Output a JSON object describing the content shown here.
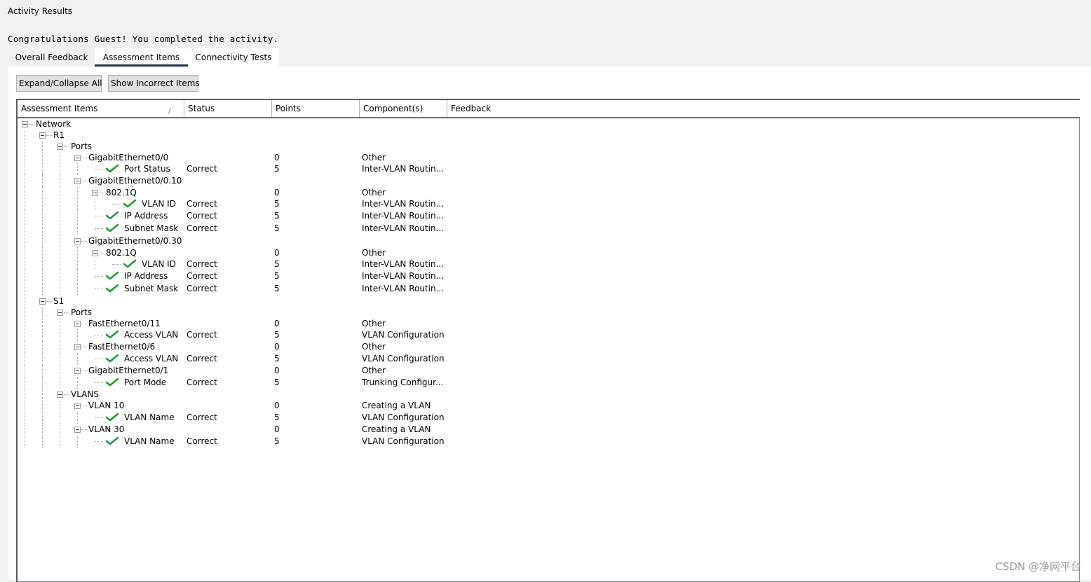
{
  "window": {
    "title": "Activity Results"
  },
  "message": "Congratulations Guest! You completed the activity.",
  "tabs": [
    {
      "label": "Overall Feedback",
      "active": false
    },
    {
      "label": "Assessment Items",
      "active": true
    },
    {
      "label": "Connectivity Tests",
      "active": false
    }
  ],
  "toolbar": {
    "expand_label": "Expand/Collapse All",
    "incorrect_label": "Show Incorrect Items"
  },
  "columns": [
    "Assessment Items",
    "Status",
    "Points",
    "Component(s)",
    "Feedback"
  ],
  "tree": [
    {
      "depth": 0,
      "expandable": true,
      "checked": false,
      "label": "Network",
      "status": "",
      "points": "",
      "component": ""
    },
    {
      "depth": 1,
      "expandable": true,
      "checked": false,
      "label": "R1",
      "status": "",
      "points": "",
      "component": ""
    },
    {
      "depth": 2,
      "expandable": true,
      "checked": false,
      "label": "Ports",
      "status": "",
      "points": "",
      "component": ""
    },
    {
      "depth": 3,
      "expandable": true,
      "checked": false,
      "label": "GigabitEthernet0/0",
      "status": "",
      "points": "0",
      "component": "Other"
    },
    {
      "depth": 4,
      "expandable": false,
      "checked": true,
      "label": "Port Status",
      "status": "Correct",
      "points": "5",
      "component": "Inter-VLAN Routin..."
    },
    {
      "depth": 3,
      "expandable": true,
      "checked": false,
      "label": "GigabitEthernet0/0.10",
      "status": "",
      "points": "",
      "component": ""
    },
    {
      "depth": 4,
      "expandable": true,
      "checked": false,
      "label": "802.1Q",
      "status": "",
      "points": "0",
      "component": "Other"
    },
    {
      "depth": 5,
      "expandable": false,
      "checked": true,
      "label": "VLAN ID",
      "status": "Correct",
      "points": "5",
      "component": "Inter-VLAN Routin..."
    },
    {
      "depth": 4,
      "expandable": false,
      "checked": true,
      "label": "IP Address",
      "status": "Correct",
      "points": "5",
      "component": "Inter-VLAN Routin..."
    },
    {
      "depth": 4,
      "expandable": false,
      "checked": true,
      "label": "Subnet Mask",
      "status": "Correct",
      "points": "5",
      "component": "Inter-VLAN Routin..."
    },
    {
      "depth": 3,
      "expandable": true,
      "checked": false,
      "label": "GigabitEthernet0/0.30",
      "status": "",
      "points": "",
      "component": ""
    },
    {
      "depth": 4,
      "expandable": true,
      "checked": false,
      "label": "802.1Q",
      "status": "",
      "points": "0",
      "component": "Other"
    },
    {
      "depth": 5,
      "expandable": false,
      "checked": true,
      "label": "VLAN ID",
      "status": "Correct",
      "points": "5",
      "component": "Inter-VLAN Routin..."
    },
    {
      "depth": 4,
      "expandable": false,
      "checked": true,
      "label": "IP Address",
      "status": "Correct",
      "points": "5",
      "component": "Inter-VLAN Routin..."
    },
    {
      "depth": 4,
      "expandable": false,
      "checked": true,
      "label": "Subnet Mask",
      "status": "Correct",
      "points": "5",
      "component": "Inter-VLAN Routin..."
    },
    {
      "depth": 1,
      "expandable": true,
      "checked": false,
      "label": "S1",
      "status": "",
      "points": "",
      "component": ""
    },
    {
      "depth": 2,
      "expandable": true,
      "checked": false,
      "label": "Ports",
      "status": "",
      "points": "",
      "component": ""
    },
    {
      "depth": 3,
      "expandable": true,
      "checked": false,
      "label": "FastEthernet0/11",
      "status": "",
      "points": "0",
      "component": "Other"
    },
    {
      "depth": 4,
      "expandable": false,
      "checked": true,
      "label": "Access VLAN",
      "status": "Correct",
      "points": "5",
      "component": "VLAN Configuration"
    },
    {
      "depth": 3,
      "expandable": true,
      "checked": false,
      "label": "FastEthernet0/6",
      "status": "",
      "points": "0",
      "component": "Other"
    },
    {
      "depth": 4,
      "expandable": false,
      "checked": true,
      "label": "Access VLAN",
      "status": "Correct",
      "points": "5",
      "component": "VLAN Configuration"
    },
    {
      "depth": 3,
      "expandable": true,
      "checked": false,
      "label": "GigabitEthernet0/1",
      "status": "",
      "points": "0",
      "component": "Other"
    },
    {
      "depth": 4,
      "expandable": false,
      "checked": true,
      "label": "Port Mode",
      "status": "Correct",
      "points": "5",
      "component": "Trunking Configur..."
    },
    {
      "depth": 2,
      "expandable": true,
      "checked": false,
      "label": "VLANS",
      "status": "",
      "points": "",
      "component": ""
    },
    {
      "depth": 3,
      "expandable": true,
      "checked": false,
      "label": "VLAN 10",
      "status": "",
      "points": "0",
      "component": "Creating a VLAN"
    },
    {
      "depth": 4,
      "expandable": false,
      "checked": true,
      "label": "VLAN Name",
      "status": "Correct",
      "points": "5",
      "component": "VLAN Configuration"
    },
    {
      "depth": 3,
      "expandable": true,
      "checked": false,
      "label": "VLAN 30",
      "status": "",
      "points": "0",
      "component": "Creating a VLAN"
    },
    {
      "depth": 4,
      "expandable": false,
      "checked": true,
      "label": "VLAN Name",
      "status": "Correct",
      "points": "5",
      "component": "VLAN Configuration"
    }
  ],
  "colors": {
    "check": "#1f9a2c",
    "tab_underline": "#1c2f4f"
  },
  "watermark": "CSDN @净网平台"
}
